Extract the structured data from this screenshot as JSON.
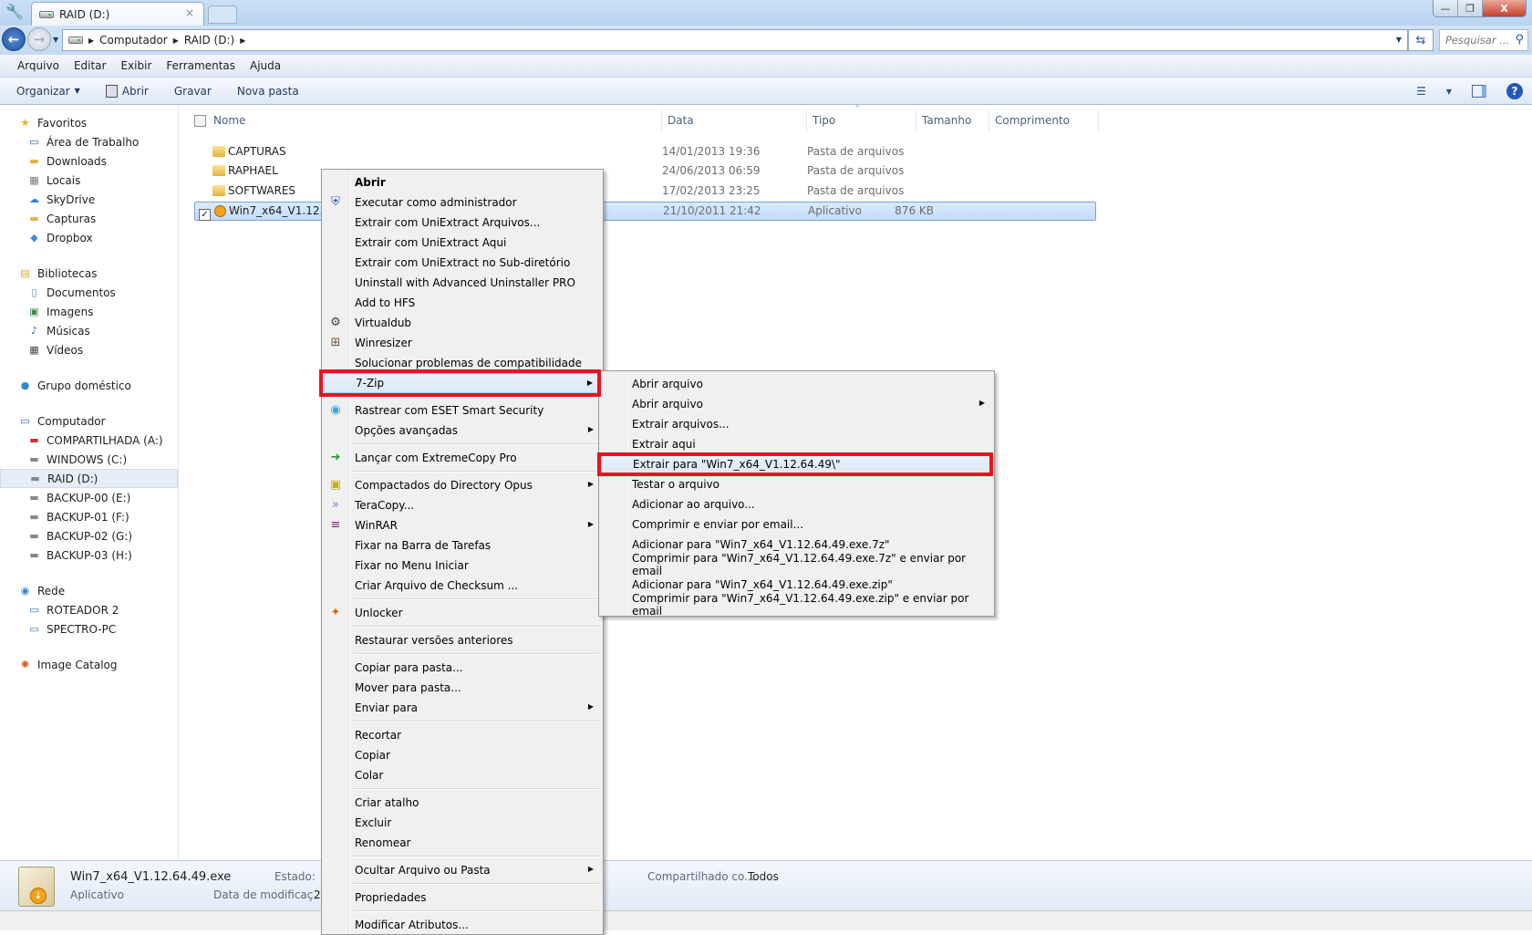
{
  "window": {
    "tab_title": "RAID (D:)",
    "tab_close": "×",
    "minimize": "—",
    "restore": "❐",
    "close": "X"
  },
  "address": {
    "crumbs": [
      "Computador",
      "RAID (D:)"
    ],
    "search_placeholder": "Pesquisar ..."
  },
  "menubar": [
    "Arquivo",
    "Editar",
    "Exibir",
    "Ferramentas",
    "Ajuda"
  ],
  "toolbar": {
    "organize": "Organizar",
    "open": "Abrir",
    "burn": "Gravar",
    "new_folder": "Nova pasta"
  },
  "sidebar": [
    {
      "label": "Favoritos",
      "level": "group",
      "icon": "star-icon"
    },
    {
      "label": "Área de Trabalho",
      "level": "child",
      "icon": "desktop-icon"
    },
    {
      "label": "Downloads",
      "level": "child",
      "icon": "folder-icon"
    },
    {
      "label": "Locais",
      "level": "child",
      "icon": "places-icon"
    },
    {
      "label": "SkyDrive",
      "level": "child",
      "icon": "cloud-icon"
    },
    {
      "label": "Capturas",
      "level": "child",
      "icon": "folder-icon"
    },
    {
      "label": "Dropbox",
      "level": "child",
      "icon": "dropbox-icon"
    },
    {
      "gap": true
    },
    {
      "label": "Bibliotecas",
      "level": "group",
      "icon": "library-icon"
    },
    {
      "label": "Documentos",
      "level": "child",
      "icon": "document-icon"
    },
    {
      "label": "Imagens",
      "level": "child",
      "icon": "image-icon"
    },
    {
      "label": "Músicas",
      "level": "child",
      "icon": "music-icon"
    },
    {
      "label": "Vídeos",
      "level": "child",
      "icon": "video-icon"
    },
    {
      "gap": true
    },
    {
      "label": "Grupo doméstico",
      "level": "group",
      "icon": "homegroup-icon"
    },
    {
      "gap": true
    },
    {
      "label": "Computador",
      "level": "group",
      "icon": "computer-icon"
    },
    {
      "label": "COMPARTILHADA (A:)",
      "level": "child",
      "icon": "network-drive-icon"
    },
    {
      "label": "WINDOWS (C:)",
      "level": "child",
      "icon": "drive-icon"
    },
    {
      "label": "RAID (D:)",
      "level": "child",
      "icon": "drive-icon",
      "selected": true
    },
    {
      "label": "BACKUP-00 (E:)",
      "level": "child",
      "icon": "drive-icon"
    },
    {
      "label": "BACKUP-01 (F:)",
      "level": "child",
      "icon": "drive-icon"
    },
    {
      "label": "BACKUP-02 (G:)",
      "level": "child",
      "icon": "drive-icon"
    },
    {
      "label": "BACKUP-03 (H:)",
      "level": "child",
      "icon": "drive-icon"
    },
    {
      "gap": true
    },
    {
      "label": "Rede",
      "level": "group",
      "icon": "network-icon"
    },
    {
      "label": "ROTEADOR 2",
      "level": "child",
      "icon": "computer-icon"
    },
    {
      "label": "SPECTRO-PC",
      "level": "child",
      "icon": "computer-icon"
    },
    {
      "gap": true
    },
    {
      "label": "Image Catalog",
      "level": "group",
      "icon": "image-catalog-icon"
    }
  ],
  "columns": [
    "Nome",
    "Data",
    "Tipo",
    "Tamanho",
    "Comprimento"
  ],
  "files": [
    {
      "name": "CAPTURAS",
      "date": "14/01/2013 19:36",
      "type": "Pasta de arquivos",
      "size": ""
    },
    {
      "name": "RAPHAEL",
      "date": "24/06/2013 06:59",
      "type": "Pasta de arquivos",
      "size": ""
    },
    {
      "name": "SOFTWARES",
      "date": "17/02/2013 23:25",
      "type": "Pasta de arquivos",
      "size": ""
    },
    {
      "name": "Win7_x64_V1.12.64.49.exe",
      "date": "21/10/2011 21:42",
      "type": "Aplicativo",
      "size": "876 KB",
      "selected": true
    }
  ],
  "context_menu": [
    {
      "label": "Abrir",
      "bold": true
    },
    {
      "label": "Executar como administrador",
      "icon": "uac-shield-icon"
    },
    {
      "label": "Extrair com UniExtract Arquivos..."
    },
    {
      "label": "Extrair com UniExtract Aqui"
    },
    {
      "label": "Extrair com UniExtract no Sub-diretório"
    },
    {
      "label": "Uninstall with Advanced Uninstaller PRO"
    },
    {
      "label": "Add to HFS"
    },
    {
      "label": "Virtualdub",
      "icon": "virtualdub-icon"
    },
    {
      "label": "Winresizer",
      "icon": "winresizer-icon"
    },
    {
      "label": "Solucionar problemas de compatibilidade"
    },
    {
      "label": "7-Zip",
      "submenu": true,
      "highlighted": true
    },
    {
      "sep": true
    },
    {
      "label": "Rastrear com ESET Smart Security",
      "icon": "eset-icon"
    },
    {
      "label": "Opções avançadas",
      "submenu": true
    },
    {
      "sep": true
    },
    {
      "label": "Lançar com ExtremeCopy Pro",
      "icon": "extremecopy-icon"
    },
    {
      "sep": true
    },
    {
      "label": "Compactados do Directory Opus",
      "icon": "directory-opus-icon",
      "submenu": true
    },
    {
      "label": "TeraCopy...",
      "icon": "teracopy-icon"
    },
    {
      "label": "WinRAR",
      "icon": "winrar-icon",
      "submenu": true
    },
    {
      "label": "Fixar na Barra de Tarefas"
    },
    {
      "label": "Fixar no Menu Iniciar"
    },
    {
      "label": "Criar Arquivo de Checksum ..."
    },
    {
      "sep": true
    },
    {
      "label": "Unlocker",
      "icon": "unlocker-wand-icon"
    },
    {
      "sep": true
    },
    {
      "label": "Restaurar versões anteriores"
    },
    {
      "sep": true
    },
    {
      "label": "Copiar para pasta..."
    },
    {
      "label": "Mover para pasta..."
    },
    {
      "label": "Enviar para",
      "submenu": true
    },
    {
      "sep": true
    },
    {
      "label": "Recortar"
    },
    {
      "label": "Copiar"
    },
    {
      "label": "Colar"
    },
    {
      "sep": true
    },
    {
      "label": "Criar atalho"
    },
    {
      "label": "Excluir"
    },
    {
      "label": "Renomear"
    },
    {
      "sep": true
    },
    {
      "label": "Ocultar Arquivo ou Pasta",
      "submenu": true
    },
    {
      "sep": true
    },
    {
      "label": "Propriedades"
    },
    {
      "sep": true
    },
    {
      "label": "Modificar Atributos..."
    }
  ],
  "zip_submenu": [
    {
      "label": "Abrir arquivo"
    },
    {
      "label": "Abrir arquivo",
      "submenu": true
    },
    {
      "label": "Extrair arquivos..."
    },
    {
      "label": "Extrair aqui"
    },
    {
      "label": "Extrair para \"Win7_x64_V1.12.64.49\\\"",
      "highlighted": true
    },
    {
      "label": "Testar o arquivo"
    },
    {
      "label": "Adicionar ao arquivo..."
    },
    {
      "label": "Comprimir e enviar por email..."
    },
    {
      "label": "Adicionar para \"Win7_x64_V1.12.64.49.exe.7z\""
    },
    {
      "label": "Comprimir para \"Win7_x64_V1.12.64.49.exe.7z\" e enviar por email"
    },
    {
      "label": "Adicionar para \"Win7_x64_V1.12.64.49.exe.zip\""
    },
    {
      "label": "Comprimir para \"Win7_x64_V1.12.64.49.exe.zip\" e enviar por email"
    }
  ],
  "details": {
    "filename": "Win7_x64_V1.12.64.49.exe",
    "filetype": "Aplicativo",
    "state_label": "Estado:",
    "modified_label": "Data de modificaç...",
    "modified_value": "2",
    "shared_label": "Compartilhado co...",
    "shared_value": "Todos"
  },
  "colors": {
    "highlight_box": "#e8141c",
    "selection": "#cce4fb"
  }
}
